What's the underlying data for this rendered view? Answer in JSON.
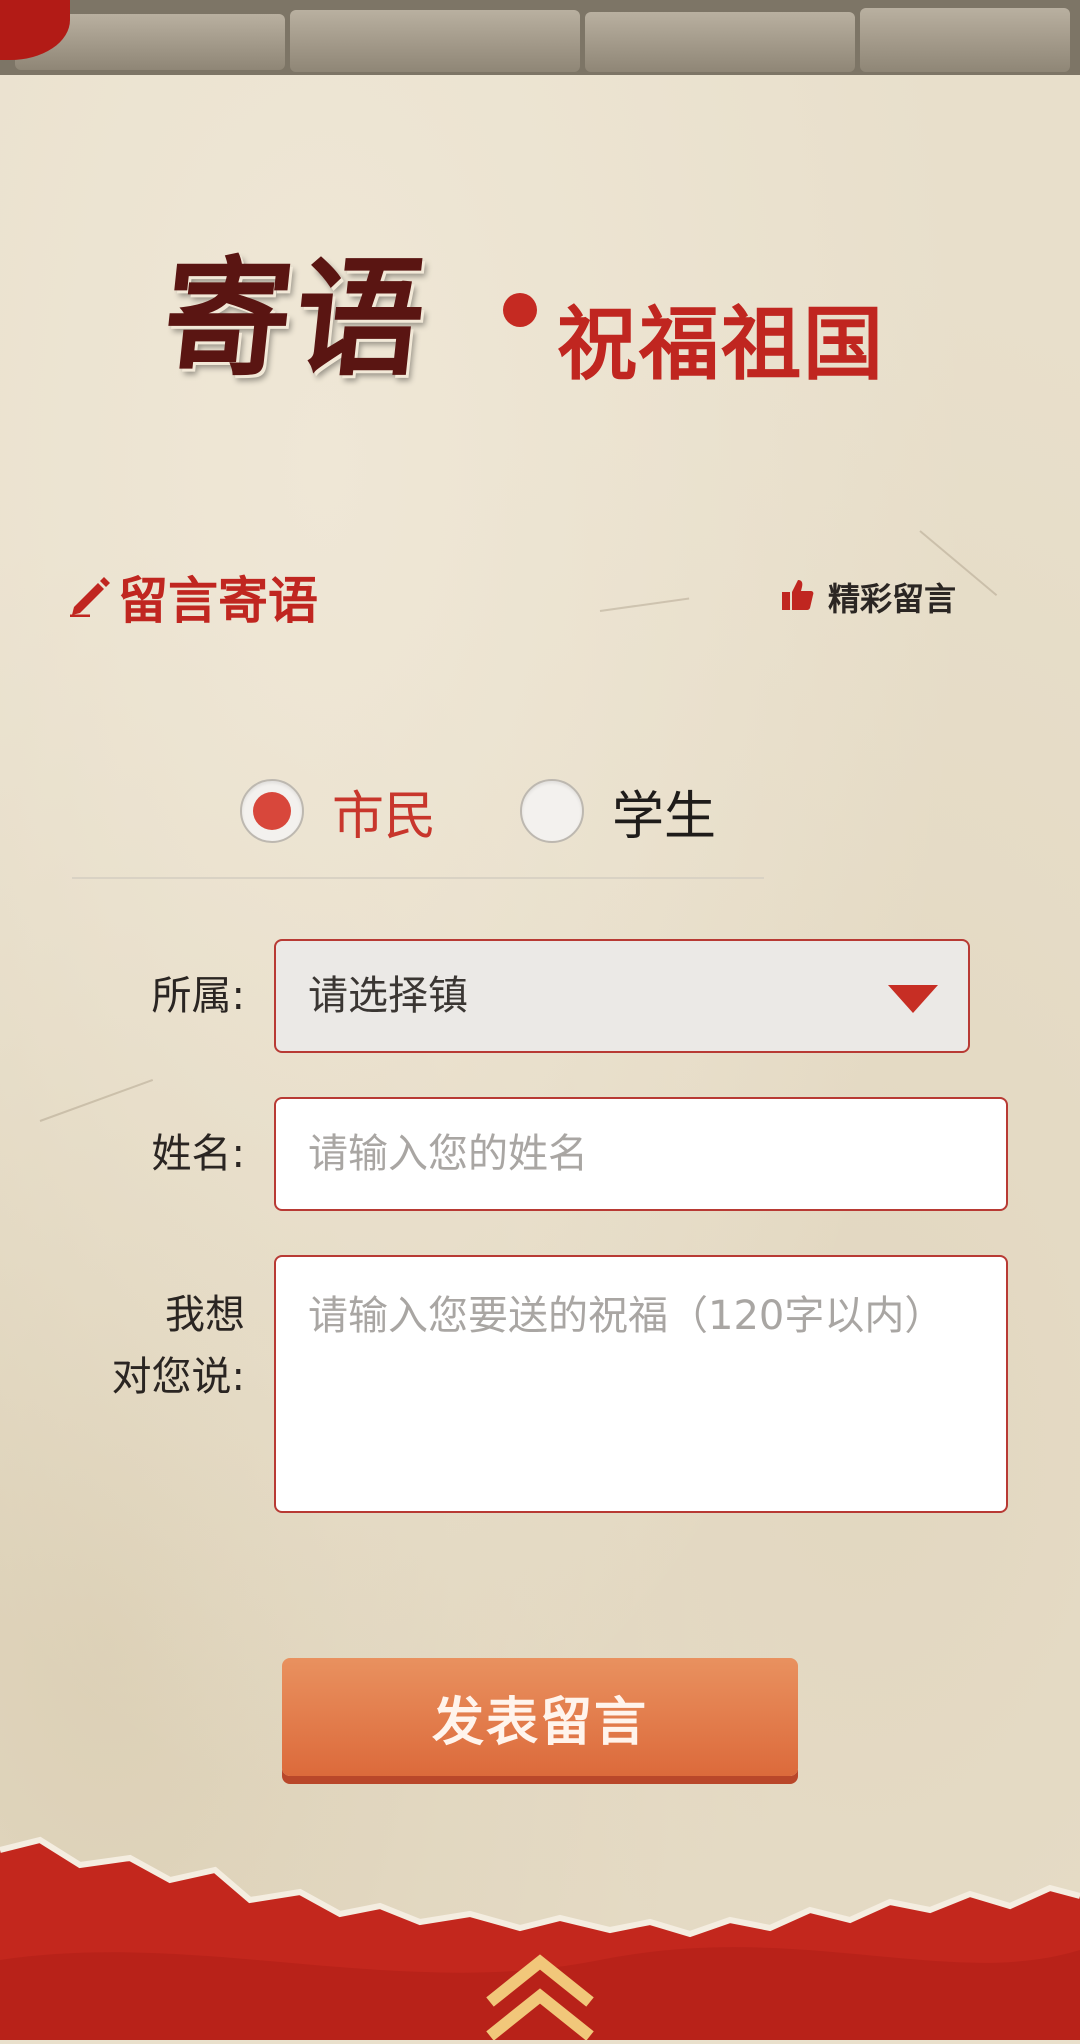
{
  "header": {
    "title_main": "寄语",
    "title_sub": "祝福祖国"
  },
  "section": {
    "left_label": "留言寄语",
    "left_icon": "pencil-icon",
    "right_label": "精彩留言",
    "right_icon": "thumbs-up-icon"
  },
  "identity": {
    "options": [
      {
        "label": "市民",
        "selected": true
      },
      {
        "label": "学生",
        "selected": false
      }
    ]
  },
  "form": {
    "affiliation_label": "所属:",
    "affiliation_value": "请选择镇",
    "name_label": "姓名:",
    "name_placeholder": "请输入您的姓名",
    "message_label_line1": "我想",
    "message_label_line2": "对您说:",
    "message_placeholder": "请输入您要送的祝福（120字以内）"
  },
  "submit": {
    "label": "发表留言"
  },
  "footer": {
    "icon": "double-chevron-up-icon"
  },
  "colors": {
    "brand_red": "#c02620",
    "paper": "#e8dfcb",
    "button": "#e07d4c"
  }
}
